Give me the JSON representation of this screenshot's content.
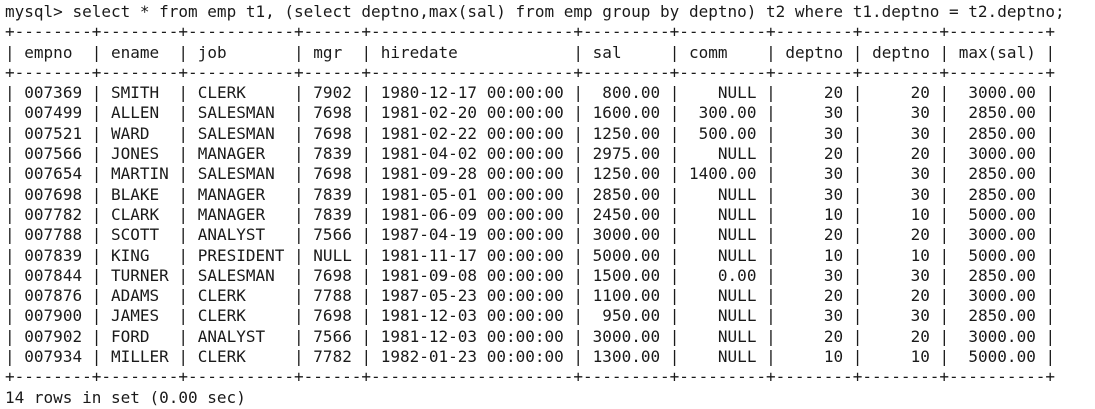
{
  "terminal": {
    "prompt": "mysql>",
    "command": "select * from emp t1, (select deptno,max(sal) from emp group by deptno) t2 where t1.deptno = t2.deptno;",
    "table": {
      "columns": [
        "empno",
        "ename",
        "job",
        "mgr",
        "hiredate",
        "sal",
        "comm",
        "deptno",
        "deptno",
        "max(sal)"
      ],
      "rows": [
        [
          "007369",
          "SMITH",
          "CLERK",
          "7902",
          "1980-12-17 00:00:00",
          "800.00",
          "NULL",
          "20",
          "20",
          "3000.00"
        ],
        [
          "007499",
          "ALLEN",
          "SALESMAN",
          "7698",
          "1981-02-20 00:00:00",
          "1600.00",
          "300.00",
          "30",
          "30",
          "2850.00"
        ],
        [
          "007521",
          "WARD",
          "SALESMAN",
          "7698",
          "1981-02-22 00:00:00",
          "1250.00",
          "500.00",
          "30",
          "30",
          "2850.00"
        ],
        [
          "007566",
          "JONES",
          "MANAGER",
          "7839",
          "1981-04-02 00:00:00",
          "2975.00",
          "NULL",
          "20",
          "20",
          "3000.00"
        ],
        [
          "007654",
          "MARTIN",
          "SALESMAN",
          "7698",
          "1981-09-28 00:00:00",
          "1250.00",
          "1400.00",
          "30",
          "30",
          "2850.00"
        ],
        [
          "007698",
          "BLAKE",
          "MANAGER",
          "7839",
          "1981-05-01 00:00:00",
          "2850.00",
          "NULL",
          "30",
          "30",
          "2850.00"
        ],
        [
          "007782",
          "CLARK",
          "MANAGER",
          "7839",
          "1981-06-09 00:00:00",
          "2450.00",
          "NULL",
          "10",
          "10",
          "5000.00"
        ],
        [
          "007788",
          "SCOTT",
          "ANALYST",
          "7566",
          "1987-04-19 00:00:00",
          "3000.00",
          "NULL",
          "20",
          "20",
          "3000.00"
        ],
        [
          "007839",
          "KING",
          "PRESIDENT",
          "NULL",
          "1981-11-17 00:00:00",
          "5000.00",
          "NULL",
          "10",
          "10",
          "5000.00"
        ],
        [
          "007844",
          "TURNER",
          "SALESMAN",
          "7698",
          "1981-09-08 00:00:00",
          "1500.00",
          "0.00",
          "30",
          "30",
          "2850.00"
        ],
        [
          "007876",
          "ADAMS",
          "CLERK",
          "7788",
          "1987-05-23 00:00:00",
          "1100.00",
          "NULL",
          "20",
          "20",
          "3000.00"
        ],
        [
          "007900",
          "JAMES",
          "CLERK",
          "7698",
          "1981-12-03 00:00:00",
          "950.00",
          "NULL",
          "30",
          "30",
          "2850.00"
        ],
        [
          "007902",
          "FORD",
          "ANALYST",
          "7566",
          "1981-12-03 00:00:00",
          "3000.00",
          "NULL",
          "20",
          "20",
          "3000.00"
        ],
        [
          "007934",
          "MILLER",
          "CLERK",
          "7782",
          "1982-01-23 00:00:00",
          "1300.00",
          "NULL",
          "10",
          "10",
          "5000.00"
        ]
      ]
    },
    "summary": "14 rows in set (0.00 sec)"
  },
  "colors": {
    "background": "#ffffff",
    "text": "#1a1a1a"
  }
}
